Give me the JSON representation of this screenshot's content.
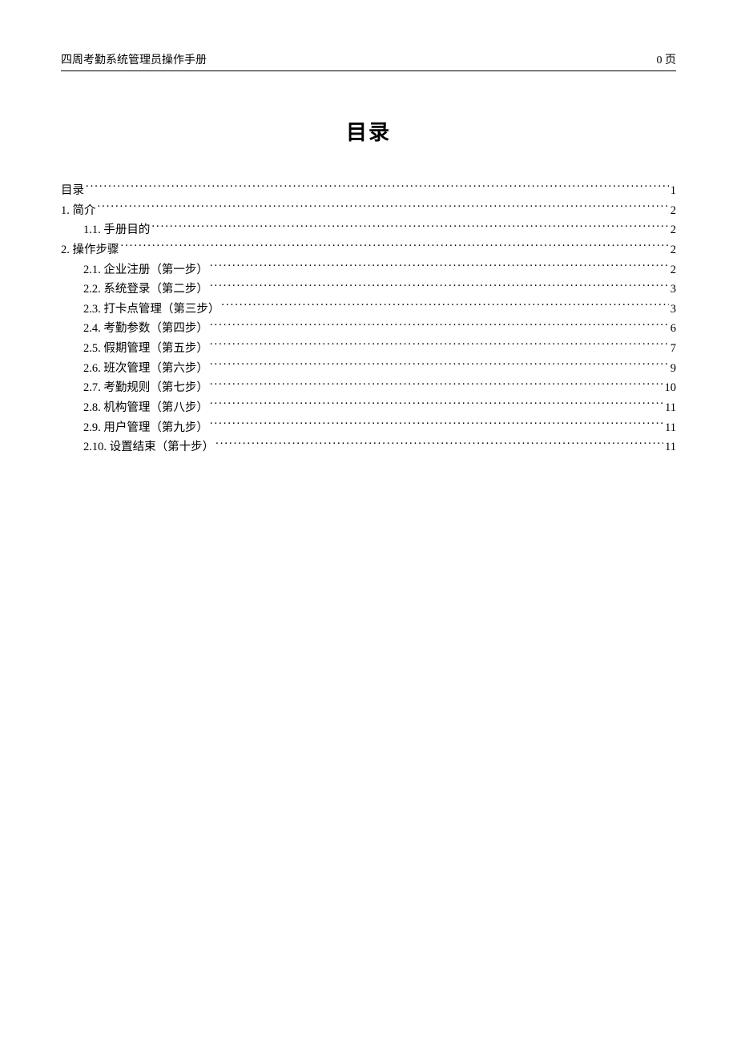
{
  "header": {
    "left": "四周考勤系统管理员操作手册",
    "right": "0 页"
  },
  "title": "目录",
  "toc": [
    {
      "level": 0,
      "label": "目录",
      "page": "1"
    },
    {
      "level": 0,
      "label": "1. 简介",
      "page": "2"
    },
    {
      "level": 1,
      "label": "1.1. 手册目的",
      "page": "2"
    },
    {
      "level": 0,
      "label": "2. 操作步骤",
      "page": "2"
    },
    {
      "level": 1,
      "label": "2.1. 企业注册（第一步）",
      "page": "2"
    },
    {
      "level": 1,
      "label": "2.2. 系统登录（第二步）",
      "page": "3"
    },
    {
      "level": 1,
      "label": "2.3. 打卡点管理（第三步）",
      "page": "3"
    },
    {
      "level": 1,
      "label": "2.4. 考勤参数（第四步）",
      "page": "6"
    },
    {
      "level": 1,
      "label": "2.5. 假期管理（第五步）",
      "page": "7"
    },
    {
      "level": 1,
      "label": "2.6. 班次管理（第六步）",
      "page": "9"
    },
    {
      "level": 1,
      "label": "2.7. 考勤规则（第七步）",
      "page": "10"
    },
    {
      "level": 1,
      "label": "2.8. 机构管理（第八步）",
      "page": "11"
    },
    {
      "level": 1,
      "label": "2.9. 用户管理（第九步）",
      "page": "11"
    },
    {
      "level": 1,
      "label": "2.10. 设置结束（第十步）",
      "page": "11"
    }
  ]
}
